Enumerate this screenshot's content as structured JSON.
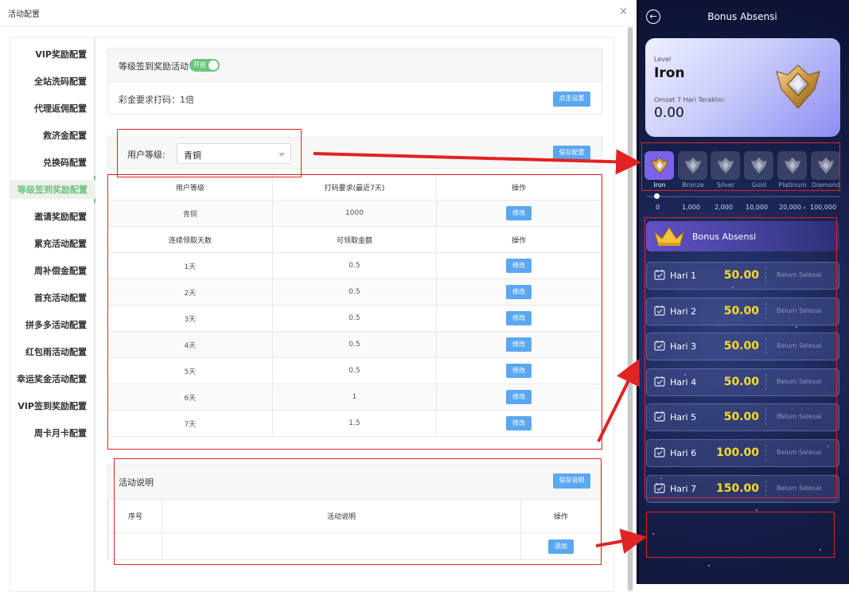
{
  "window": {
    "title": "活动配置",
    "close_glyph": "×"
  },
  "sidebar": {
    "items": [
      "VIP奖励配置",
      "全站洗码配置",
      "代理返佣配置",
      "救济金配置",
      "兑换码配置",
      "等级签到奖励配置",
      "邀请奖励配置",
      "累充活动配置",
      "周补偿金配置",
      "首充活动配置",
      "拼多多活动配置",
      "红包雨活动配置",
      "幸运奖金活动配置",
      "VIP签到奖励配置",
      "周卡月卡配置"
    ],
    "active_index": 5
  },
  "activity": {
    "title": "等级签到奖励活动",
    "toggle_label": "开启",
    "toggle_on": true,
    "wager_text": "彩金要求打码：1倍",
    "settings_button": "点击设置"
  },
  "level_select": {
    "label": "用户等级:",
    "value": "青铜",
    "save_button": "保存配置"
  },
  "level_table": {
    "headers": [
      "用户等级",
      "打码要求(最近7天)",
      "操作"
    ],
    "row": {
      "level": "青铜",
      "requirement": "1000",
      "action": "修改"
    },
    "day_headers": [
      "连续领取天数",
      "可领取金额",
      "操作"
    ],
    "days": [
      {
        "day": "1天",
        "amount": "0.5",
        "action": "修改"
      },
      {
        "day": "2天",
        "amount": "0.5",
        "action": "修改"
      },
      {
        "day": "3天",
        "amount": "0.5",
        "action": "修改"
      },
      {
        "day": "4天",
        "amount": "0.5",
        "action": "修改"
      },
      {
        "day": "5天",
        "amount": "0.5",
        "action": "修改"
      },
      {
        "day": "6天",
        "amount": "1",
        "action": "修改"
      },
      {
        "day": "7天",
        "amount": "1.5",
        "action": "修改"
      }
    ]
  },
  "description": {
    "title": "活动说明",
    "save_button": "保存说明",
    "headers": [
      "序号",
      "活动说明",
      "操作"
    ],
    "add_button": "添加"
  },
  "phone": {
    "back_glyph": "←",
    "title": "Bonus Absensi",
    "level_label": "Level",
    "level_name": "Iron",
    "omset_label": "Omset 7 Hari Terakhir:",
    "omset_value": "0.00",
    "tiers": [
      "Iron",
      "Bronze",
      "Silver",
      "Gold",
      "Platinum",
      "Diamond"
    ],
    "active_tier": 0,
    "thresholds": [
      "0",
      "1,000",
      "2,000",
      "10,000",
      "20,000",
      "100,000"
    ],
    "bonus_header": "Bonus Absensi",
    "days": [
      {
        "label": "Hari 1",
        "amount": "50.00",
        "status": "Belum Selesai"
      },
      {
        "label": "Hari 2",
        "amount": "50.00",
        "status": "Belum Selesai"
      },
      {
        "label": "Hari 3",
        "amount": "50.00",
        "status": "Belum Selesai"
      },
      {
        "label": "Hari 4",
        "amount": "50.00",
        "status": "Belum Selesai"
      },
      {
        "label": "Hari 5",
        "amount": "50.00",
        "status": "Belum Selesai"
      },
      {
        "label": "Hari 6",
        "amount": "100.00",
        "status": "Belum Selesai"
      },
      {
        "label": "Hari 7",
        "amount": "150.00",
        "status": "Belum Selesai"
      }
    ]
  },
  "colors": {
    "accent_green": "#6cc57e",
    "button_blue": "#5ba8f0",
    "annotation_red": "#e02424",
    "amount_yellow": "#f6dd2a",
    "tier_active": "#7c62e8"
  }
}
